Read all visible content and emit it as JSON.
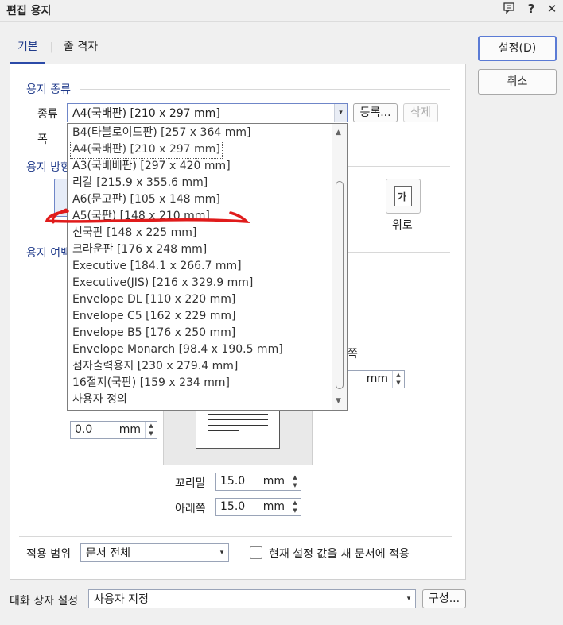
{
  "window": {
    "title": "편집 용지"
  },
  "titlebar_icons": [
    "comment-icon",
    "help-icon",
    "close-icon"
  ],
  "titlebar_glyphs": {
    "help": "?",
    "close": "✕"
  },
  "tabs": [
    {
      "label": "기본"
    },
    {
      "label": "줄 격자"
    }
  ],
  "buttons": {
    "ok": "설정(D)",
    "cancel": "취소",
    "register": "등록...",
    "delete": "삭제",
    "configure": "구성..."
  },
  "paper_type": {
    "section_title": "용지 종류",
    "type_label": "종류",
    "selected": "A4(국배판) [210 x 297 mm]",
    "width_label": "폭",
    "options": [
      "B4(타블로이드판) [257 x 364 mm]",
      "A4(국배판) [210 x 297 mm]",
      "A3(국배배판) [297 x 420 mm]",
      "리갈 [215.9 x 355.6 mm]",
      "A6(문고판) [105 x 148 mm]",
      "A5(국판) [148 x 210 mm]",
      "신국판 [148 x 225 mm]",
      "크라운판 [176 x 248 mm]",
      "Executive [184.1 x 266.7 mm]",
      "Executive(JIS) [216 x 329.9 mm]",
      "Envelope DL [110 x 220 mm]",
      "Envelope C5 [162 x 229 mm]",
      "Envelope B5 [176 x 250 mm]",
      "Envelope Monarch [98.4 x 190.5 mm]",
      "점자출력용지 [230 x 279.4 mm]",
      "16절지(국판) [159 x 234 mm]",
      "사용자 정의"
    ],
    "highlighted_index": 1
  },
  "orientation": {
    "section_title": "용지 방향",
    "landscape_label": "위로",
    "icon_glyph": "가"
  },
  "margins": {
    "section_title": "용지 여백",
    "left_value": "0.0",
    "right_unit": "mm",
    "unit": "mm",
    "footer_label": "꼬리말",
    "footer_value": "15.0",
    "bottom_label": "아래쪽",
    "bottom_value": "15.0",
    "partial_label": "쪽"
  },
  "apply": {
    "scope_label": "적용 범위",
    "scope_value": "문서 전체",
    "checkbox_label": "현재 설정 값을 새 문서에 적용"
  },
  "dialog_settings": {
    "label": "대화 상자 설정",
    "value": "사용자 지정"
  },
  "colors": {
    "accent": "#1f3a8a",
    "annotation": "#e01b1b"
  }
}
